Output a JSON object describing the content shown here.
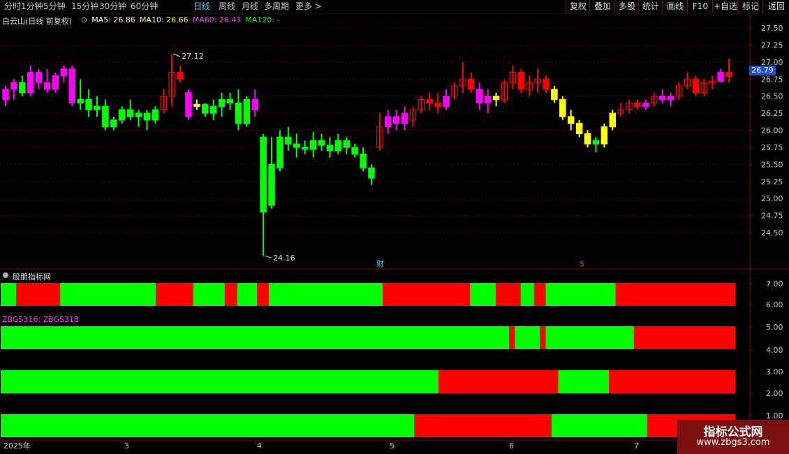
{
  "toolbar": {
    "periods": [
      "分时",
      "1分钟",
      "5分钟",
      "15分钟",
      "30分钟",
      "60分钟",
      "日线",
      "周线",
      "月线",
      "多周期",
      "更多"
    ],
    "active_period": "日线",
    "right_buttons": [
      "复权",
      "叠加",
      "多股",
      "统计",
      "画线",
      "F10",
      "+自选",
      "标记",
      "返回"
    ]
  },
  "stock": {
    "title": "白云山(日线 前复权)",
    "ma": [
      {
        "label": "MA5: 26.86",
        "color": "#ffffff"
      },
      {
        "label": "MA10: 26.66",
        "color": "#ffff00"
      },
      {
        "label": "MA60: 26.43",
        "color": "#ff40ff"
      },
      {
        "label": "MA120: -",
        "color": "#00ff00"
      }
    ],
    "high_marker": "27.12",
    "low_marker": "24.16",
    "last_price": "26.79",
    "event_markers": [
      {
        "label": "财",
        "color": "#4fd3ff"
      },
      {
        "label": "$",
        "color": "#ff3030"
      }
    ]
  },
  "price_axis": {
    "ticks": [
      "27.50",
      "27.25",
      "27.00",
      "26.75",
      "26.50",
      "26.25",
      "26.00",
      "25.75",
      "25.50",
      "25.25",
      "25.00",
      "24.75",
      "24.50"
    ],
    "min": 24.16,
    "max": 27.12
  },
  "indicator": {
    "name": "股朋指标网",
    "formula": "ZBGS316: ZBGS318",
    "axis_ticks": [
      "7.00",
      "6.00",
      "5.00",
      "4.00",
      "3.00",
      "2.00",
      "1.00"
    ],
    "colors": {
      "green": "#00ff00",
      "red": "#ff0000"
    },
    "rows": [
      {
        "name": "row-1",
        "segments": [
          [
            "green",
            0.0,
            0.021
          ],
          [
            "red",
            0.021,
            0.081
          ],
          [
            "green",
            0.081,
            0.211
          ],
          [
            "red",
            0.211,
            0.262
          ],
          [
            "green",
            0.262,
            0.305
          ],
          [
            "red",
            0.305,
            0.322
          ],
          [
            "green",
            0.322,
            0.349
          ],
          [
            "red",
            0.349,
            0.365
          ],
          [
            "green",
            0.365,
            0.52
          ],
          [
            "red",
            0.52,
            0.639
          ],
          [
            "green",
            0.639,
            0.674
          ],
          [
            "red",
            0.674,
            0.708
          ],
          [
            "green",
            0.708,
            0.726
          ],
          [
            "red",
            0.726,
            0.742
          ],
          [
            "green",
            0.742,
            0.837
          ],
          [
            "red",
            0.837,
            1.0
          ]
        ]
      },
      {
        "name": "row-2",
        "segments": [
          [
            "green",
            0.0,
            0.692
          ],
          [
            "red",
            0.692,
            0.7
          ],
          [
            "green",
            0.7,
            0.734
          ],
          [
            "red",
            0.734,
            0.742
          ],
          [
            "green",
            0.742,
            0.862
          ],
          [
            "red",
            0.862,
            1.0
          ]
        ]
      },
      {
        "name": "row-3",
        "segments": [
          [
            "green",
            0.0,
            0.596
          ],
          [
            "red",
            0.596,
            0.759
          ],
          [
            "green",
            0.759,
            0.828
          ],
          [
            "red",
            0.828,
            1.0
          ]
        ]
      },
      {
        "name": "row-4",
        "segments": [
          [
            "green",
            0.0,
            0.563
          ],
          [
            "red",
            0.563,
            0.75
          ],
          [
            "green",
            0.75,
            0.88
          ],
          [
            "red",
            0.88,
            1.0
          ]
        ]
      }
    ]
  },
  "date_axis": {
    "labels": [
      "2025年",
      "3",
      "4",
      "5",
      "6",
      "7"
    ]
  },
  "watermark": {
    "line1": "指标公式网",
    "line2": "www.zbgs3.com"
  },
  "colors": {
    "up": "#ff0000",
    "down": "#00ff00",
    "magenta": "#ff00ff",
    "yellow": "#ffff00",
    "grid": "#5a0000"
  },
  "chart_data": {
    "type": "candlestick",
    "series": [
      {
        "c": "m",
        "o": 26.45,
        "h": 26.65,
        "l": 26.35,
        "cl": 26.6
      },
      {
        "c": "m",
        "o": 26.6,
        "h": 26.75,
        "l": 26.45,
        "cl": 26.7
      },
      {
        "c": "g",
        "o": 26.7,
        "h": 26.8,
        "l": 26.5,
        "cl": 26.55
      },
      {
        "c": "m",
        "o": 26.55,
        "h": 26.95,
        "l": 26.5,
        "cl": 26.85
      },
      {
        "c": "m",
        "o": 26.85,
        "h": 26.9,
        "l": 26.6,
        "cl": 26.7
      },
      {
        "c": "m",
        "o": 26.7,
        "h": 26.9,
        "l": 26.55,
        "cl": 26.6
      },
      {
        "c": "m",
        "o": 26.6,
        "h": 26.85,
        "l": 26.55,
        "cl": 26.8
      },
      {
        "c": "m",
        "o": 26.8,
        "h": 26.95,
        "l": 26.7,
        "cl": 26.9
      },
      {
        "c": "m",
        "o": 26.9,
        "h": 26.95,
        "l": 26.35,
        "cl": 26.4
      },
      {
        "c": "g",
        "o": 26.4,
        "h": 26.75,
        "l": 26.3,
        "cl": 26.45
      },
      {
        "c": "g",
        "o": 26.45,
        "h": 26.6,
        "l": 26.2,
        "cl": 26.3
      },
      {
        "c": "g",
        "o": 26.3,
        "h": 26.5,
        "l": 26.2,
        "cl": 26.35
      },
      {
        "c": "g",
        "o": 26.35,
        "h": 26.45,
        "l": 26.0,
        "cl": 26.05
      },
      {
        "c": "g",
        "o": 26.05,
        "h": 26.2,
        "l": 26.0,
        "cl": 26.15
      },
      {
        "c": "g",
        "o": 26.15,
        "h": 26.35,
        "l": 26.1,
        "cl": 26.3
      },
      {
        "c": "g",
        "o": 26.3,
        "h": 26.45,
        "l": 26.15,
        "cl": 26.2
      },
      {
        "c": "g",
        "o": 26.2,
        "h": 26.3,
        "l": 26.05,
        "cl": 26.25
      },
      {
        "c": "g",
        "o": 26.25,
        "h": 26.3,
        "l": 26.0,
        "cl": 26.15
      },
      {
        "c": "g",
        "o": 26.15,
        "h": 26.35,
        "l": 26.1,
        "cl": 26.3
      },
      {
        "c": "r",
        "o": 26.3,
        "h": 26.6,
        "l": 26.25,
        "cl": 26.5
      },
      {
        "c": "r",
        "o": 26.5,
        "h": 27.12,
        "l": 26.35,
        "cl": 26.85
      },
      {
        "c": "r",
        "o": 26.85,
        "h": 26.95,
        "l": 26.7,
        "cl": 26.75
      },
      {
        "c": "m",
        "o": 26.55,
        "h": 26.6,
        "l": 26.15,
        "cl": 26.2
      },
      {
        "c": "y",
        "o": 26.35,
        "h": 26.45,
        "l": 26.3,
        "cl": 26.38
      },
      {
        "c": "g",
        "o": 26.38,
        "h": 26.4,
        "l": 26.2,
        "cl": 26.25
      },
      {
        "c": "g",
        "o": 26.25,
        "h": 26.45,
        "l": 26.15,
        "cl": 26.35
      },
      {
        "c": "g",
        "o": 26.35,
        "h": 26.55,
        "l": 26.2,
        "cl": 26.45
      },
      {
        "c": "g",
        "o": 26.45,
        "h": 26.55,
        "l": 26.3,
        "cl": 26.4
      },
      {
        "c": "g",
        "o": 26.4,
        "h": 26.6,
        "l": 26.0,
        "cl": 26.1
      },
      {
        "c": "g",
        "o": 26.1,
        "h": 26.5,
        "l": 26.05,
        "cl": 26.45
      },
      {
        "c": "m",
        "o": 26.45,
        "h": 26.6,
        "l": 26.2,
        "cl": 26.3
      },
      {
        "c": "g",
        "o": 25.9,
        "h": 25.95,
        "l": 24.16,
        "cl": 24.8
      },
      {
        "c": "g",
        "o": 24.9,
        "h": 25.9,
        "l": 24.85,
        "cl": 25.5
      },
      {
        "c": "g",
        "o": 25.45,
        "h": 26.0,
        "l": 25.4,
        "cl": 25.9
      },
      {
        "c": "g",
        "o": 25.9,
        "h": 26.05,
        "l": 25.7,
        "cl": 25.8
      },
      {
        "c": "g",
        "o": 25.8,
        "h": 25.95,
        "l": 25.6,
        "cl": 25.75
      },
      {
        "c": "g",
        "o": 25.75,
        "h": 25.85,
        "l": 25.65,
        "cl": 25.72
      },
      {
        "c": "g",
        "o": 25.72,
        "h": 25.98,
        "l": 25.6,
        "cl": 25.85
      },
      {
        "c": "g",
        "o": 25.85,
        "h": 25.95,
        "l": 25.7,
        "cl": 25.78
      },
      {
        "c": "g",
        "o": 25.78,
        "h": 25.9,
        "l": 25.6,
        "cl": 25.7
      },
      {
        "c": "g",
        "o": 25.7,
        "h": 25.95,
        "l": 25.65,
        "cl": 25.85
      },
      {
        "c": "g",
        "o": 25.85,
        "h": 25.9,
        "l": 25.65,
        "cl": 25.75
      },
      {
        "c": "g",
        "o": 25.75,
        "h": 25.8,
        "l": 25.6,
        "cl": 25.65
      },
      {
        "c": "g",
        "o": 25.65,
        "h": 25.75,
        "l": 25.4,
        "cl": 25.45
      },
      {
        "c": "g",
        "o": 25.45,
        "h": 25.5,
        "l": 25.2,
        "cl": 25.3
      },
      {
        "c": "r",
        "o": 25.75,
        "h": 26.25,
        "l": 25.7,
        "cl": 26.05
      },
      {
        "c": "m",
        "o": 26.05,
        "h": 26.3,
        "l": 25.95,
        "cl": 26.2
      },
      {
        "c": "m",
        "o": 26.2,
        "h": 26.3,
        "l": 26.0,
        "cl": 26.1
      },
      {
        "c": "m",
        "o": 26.1,
        "h": 26.35,
        "l": 26.0,
        "cl": 26.25
      },
      {
        "c": "r",
        "o": 26.15,
        "h": 26.35,
        "l": 26.05,
        "cl": 26.3
      },
      {
        "c": "r",
        "o": 26.3,
        "h": 26.5,
        "l": 26.25,
        "cl": 26.45
      },
      {
        "c": "r",
        "o": 26.45,
        "h": 26.55,
        "l": 26.3,
        "cl": 26.4
      },
      {
        "c": "r",
        "o": 26.4,
        "h": 26.55,
        "l": 26.25,
        "cl": 26.35
      },
      {
        "c": "m",
        "o": 26.35,
        "h": 26.6,
        "l": 26.3,
        "cl": 26.5
      },
      {
        "c": "r",
        "o": 26.5,
        "h": 26.7,
        "l": 26.45,
        "cl": 26.65
      },
      {
        "c": "r",
        "o": 26.65,
        "h": 27.0,
        "l": 26.55,
        "cl": 26.75
      },
      {
        "c": "r",
        "o": 26.75,
        "h": 26.85,
        "l": 26.55,
        "cl": 26.6
      },
      {
        "c": "m",
        "o": 26.6,
        "h": 26.7,
        "l": 26.3,
        "cl": 26.4
      },
      {
        "c": "m",
        "o": 26.4,
        "h": 26.6,
        "l": 26.25,
        "cl": 26.5
      },
      {
        "c": "y",
        "o": 26.5,
        "h": 26.55,
        "l": 26.35,
        "cl": 26.45
      },
      {
        "c": "r",
        "o": 26.45,
        "h": 26.75,
        "l": 26.4,
        "cl": 26.7
      },
      {
        "c": "r",
        "o": 26.7,
        "h": 26.95,
        "l": 26.6,
        "cl": 26.85
      },
      {
        "c": "r",
        "o": 26.85,
        "h": 26.9,
        "l": 26.55,
        "cl": 26.6
      },
      {
        "c": "r",
        "o": 26.6,
        "h": 26.8,
        "l": 26.5,
        "cl": 26.7
      },
      {
        "c": "r",
        "o": 26.7,
        "h": 26.9,
        "l": 26.55,
        "cl": 26.75
      },
      {
        "c": "r",
        "o": 26.75,
        "h": 26.8,
        "l": 26.55,
        "cl": 26.6
      },
      {
        "c": "y",
        "o": 26.6,
        "h": 26.65,
        "l": 26.4,
        "cl": 26.45
      },
      {
        "c": "y",
        "o": 26.45,
        "h": 26.5,
        "l": 26.15,
        "cl": 26.2
      },
      {
        "c": "y",
        "o": 26.2,
        "h": 26.3,
        "l": 26.0,
        "cl": 26.1
      },
      {
        "c": "y",
        "o": 26.1,
        "h": 26.15,
        "l": 25.9,
        "cl": 25.95
      },
      {
        "c": "y",
        "o": 25.95,
        "h": 26.0,
        "l": 25.75,
        "cl": 25.8
      },
      {
        "c": "g",
        "o": 25.8,
        "h": 25.9,
        "l": 25.68,
        "cl": 25.85
      },
      {
        "c": "y",
        "o": 25.8,
        "h": 26.1,
        "l": 25.75,
        "cl": 26.05
      },
      {
        "c": "y",
        "o": 26.05,
        "h": 26.3,
        "l": 26.0,
        "cl": 26.25
      },
      {
        "c": "r",
        "o": 26.25,
        "h": 26.4,
        "l": 26.2,
        "cl": 26.3
      },
      {
        "c": "r",
        "o": 26.3,
        "h": 26.45,
        "l": 26.25,
        "cl": 26.4
      },
      {
        "c": "r",
        "o": 26.4,
        "h": 26.45,
        "l": 26.3,
        "cl": 26.35
      },
      {
        "c": "m",
        "o": 26.35,
        "h": 26.45,
        "l": 26.3,
        "cl": 26.4
      },
      {
        "c": "r",
        "o": 26.4,
        "h": 26.55,
        "l": 26.35,
        "cl": 26.5
      },
      {
        "c": "m",
        "o": 26.5,
        "h": 26.6,
        "l": 26.4,
        "cl": 26.45
      },
      {
        "c": "m",
        "o": 26.45,
        "h": 26.55,
        "l": 26.35,
        "cl": 26.5
      },
      {
        "c": "r",
        "o": 26.5,
        "h": 26.7,
        "l": 26.45,
        "cl": 26.65
      },
      {
        "c": "r",
        "o": 26.65,
        "h": 26.85,
        "l": 26.6,
        "cl": 26.75
      },
      {
        "c": "r",
        "o": 26.75,
        "h": 26.8,
        "l": 26.5,
        "cl": 26.55
      },
      {
        "c": "r",
        "o": 26.55,
        "h": 26.75,
        "l": 26.5,
        "cl": 26.7
      },
      {
        "c": "r",
        "o": 26.7,
        "h": 26.8,
        "l": 26.6,
        "cl": 26.72
      },
      {
        "c": "m",
        "o": 26.72,
        "h": 26.9,
        "l": 26.7,
        "cl": 26.85
      },
      {
        "c": "r",
        "o": 26.85,
        "h": 27.05,
        "l": 26.7,
        "cl": 26.79
      }
    ]
  }
}
